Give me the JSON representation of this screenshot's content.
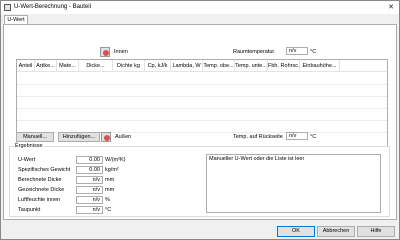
{
  "window": {
    "title": "U-Wert-Berechnung - Bauteil",
    "close_glyph": "✕"
  },
  "tab": {
    "label": "U-Wert"
  },
  "innen": {
    "label": "Innen",
    "icon": "red-circle-icon",
    "room_temp_label": "Raumtemperatur",
    "room_temp_value": "n/v",
    "room_temp_unit": "°C"
  },
  "table": {
    "columns": [
      "Anteil",
      "Artike...",
      "Mate...",
      "Dicke...",
      "Dichte kg",
      "Cp, kJ/k",
      "Lambda, W",
      "Temp. obe...",
      "Temp. unte...",
      "Fbh. Rohrsc...",
      "Einbauhöhe..."
    ],
    "rows": []
  },
  "toolbar": {
    "manual_label": "Manuell...",
    "add_label": "Hinzufügen...",
    "outside_label": "Außen",
    "outside_icon": "red-circle-icon",
    "rear_temp_label": "Temp. auf Rückseite",
    "rear_temp_value": "n/v",
    "rear_temp_unit": "°C"
  },
  "results": {
    "group_label": "Ergebnisse",
    "fields": [
      {
        "label": "U-Wert",
        "value": "0.00",
        "unit": "W/(m²K)"
      },
      {
        "label": "Spezifisches Gewicht",
        "value": "0.00",
        "unit": "kg/m²"
      },
      {
        "label": "Berechnete Dicke",
        "value": "n/v",
        "unit": "mm"
      },
      {
        "label": "Gezeichnete Dicke",
        "value": "n/v",
        "unit": "mm"
      },
      {
        "label": "Luftfeuchte innen",
        "value": "n/v",
        "unit": "%"
      },
      {
        "label": "Taupunkt",
        "value": "n/v",
        "unit": "°C"
      }
    ],
    "message": "Manueller U-Wert oder die Liste ist leer"
  },
  "footer": {
    "ok_label": "OK",
    "cancel_label": "Abbrechen",
    "help_label": "Hilfe"
  }
}
